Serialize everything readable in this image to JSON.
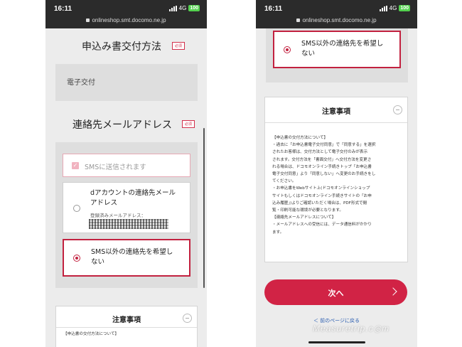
{
  "status": {
    "time": "16:11",
    "network": "4G",
    "battery": "100",
    "url": "onlineshop.smt.docomo.ne.jp"
  },
  "left": {
    "delivery_title": "申込み書交付方法",
    "required_label": "必須",
    "delivery_value": "電子交付",
    "email_title": "連絡先メールアドレス",
    "sms_sent_label": "SMSに送信されます",
    "option_d_account": "dアカウントの連絡先メール\nアドレス",
    "registered_email_label": "登録済みメールアドレス：",
    "option_other": "SMS以外の連絡先を希望し\nない",
    "notes_title": "注意事項",
    "notes_partial": "【申込書の交付方法について】"
  },
  "right": {
    "option_other": "SMS以外の連絡先を希望し\nない",
    "notes_title": "注意事項",
    "notes_text": "【申込書の交付方法について】\n・過去に「お申込書電子交付同意」で「同意する」を選択\nされたお客様は、交付方法として電子交付のみが表示\nされます。交付方法を「書面交付」へ交付方法を変更さ\nれる場合は、ドコモオンライン手続きトップ「お申込書\n電子交付同意」より「同意しない」へ変更のお手続きをし\nてください。\n・お申込書をWebサイト上(ドコモオンラインショップ\nサイトもしくはドコモオンライン手続きサイトの「お申\n込み履歴」)よりご確認いただく場合は、PDF形式で閲\n覧・印刷可能な環境が必要となります。\n【連絡先メールアドレスについて】\n・メールアドレスへの受信には、データ通信料がかかり\nます。",
    "next_label": "次へ",
    "back_link": "＜ 前のページに戻る"
  },
  "watermark": "Measuretrip.c◎m",
  "colors": {
    "accent": "#d12345",
    "background": "#ececec",
    "status_bar": "#2b2b2b"
  }
}
